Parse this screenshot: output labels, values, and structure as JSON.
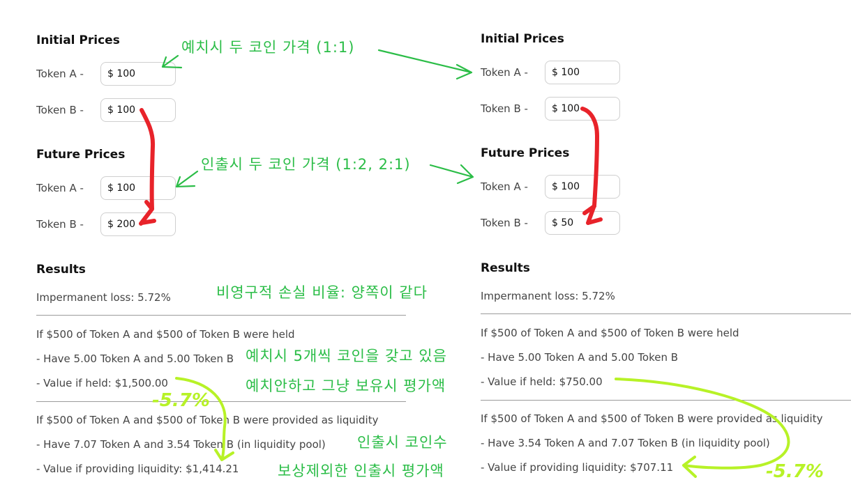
{
  "left": {
    "initial_title": "Initial Prices",
    "initial": [
      {
        "label": "Token A  -",
        "value": "$ 100"
      },
      {
        "label": "Token B  -",
        "value": "$ 100"
      }
    ],
    "future_title": "Future Prices",
    "future": [
      {
        "label": "Token A  -",
        "value": "$ 100"
      },
      {
        "label": "Token B  -",
        "value": "$ 200"
      }
    ],
    "results_title": "Results",
    "il": "Impermanent loss: 5.72%",
    "held_header": "If $500 of Token A and $500 of Token B were held",
    "held_have": "- Have 5.00 Token A and 5.00 Token B",
    "held_value": "- Value if held: $1,500.00",
    "lp_header": "If $500 of Token A and $500 of Token B were provided as liquidity",
    "lp_have": "- Have 7.07 Token A and 3.54 Token B (in liquidity pool)",
    "lp_value": "- Value if providing liquidity: $1,414.21"
  },
  "right": {
    "initial_title": "Initial Prices",
    "initial": [
      {
        "label": "Token A  -",
        "value": "$ 100"
      },
      {
        "label": "Token B  -",
        "value": "$ 100"
      }
    ],
    "future_title": "Future Prices",
    "future": [
      {
        "label": "Token A  -",
        "value": "$ 100"
      },
      {
        "label": "Token B  -",
        "value": "$ 50"
      }
    ],
    "results_title": "Results",
    "il": "Impermanent loss: 5.72%",
    "held_header": "If $500 of Token A and $500 of Token B were held",
    "held_have": "- Have 5.00 Token A and 5.00 Token B",
    "held_value": "- Value if held: $750.00",
    "lp_header": "If $500 of Token A and $500 of Token B were provided as liquidity",
    "lp_have": "- Have 3.54 Token A and 7.07 Token B (in liquidity pool)",
    "lp_value": "- Value if providing liquidity: $707.11"
  },
  "annotations": {
    "deposit_prices": "예치시 두 코인 가격 (1:1)",
    "withdraw_prices": "인출시 두 코인 가격 (1:2, 2:1)",
    "il_ratio": "비영구적 손실 비율:  양쪽이 같다",
    "holding_five": "예치시 5개씩 코인을 갖고 있음",
    "hold_value": "예치안하고 그냥 보유시 평가액",
    "withdraw_count": "인출시 코인수",
    "withdraw_value": "보상제외한 인출시 평가액",
    "left_loss": "-5.7%",
    "right_loss": "-5.7%"
  },
  "colors": {
    "annotation_green": "#2bbd47",
    "annotation_red": "#e8232a",
    "annotation_lime": "#b7f227"
  }
}
